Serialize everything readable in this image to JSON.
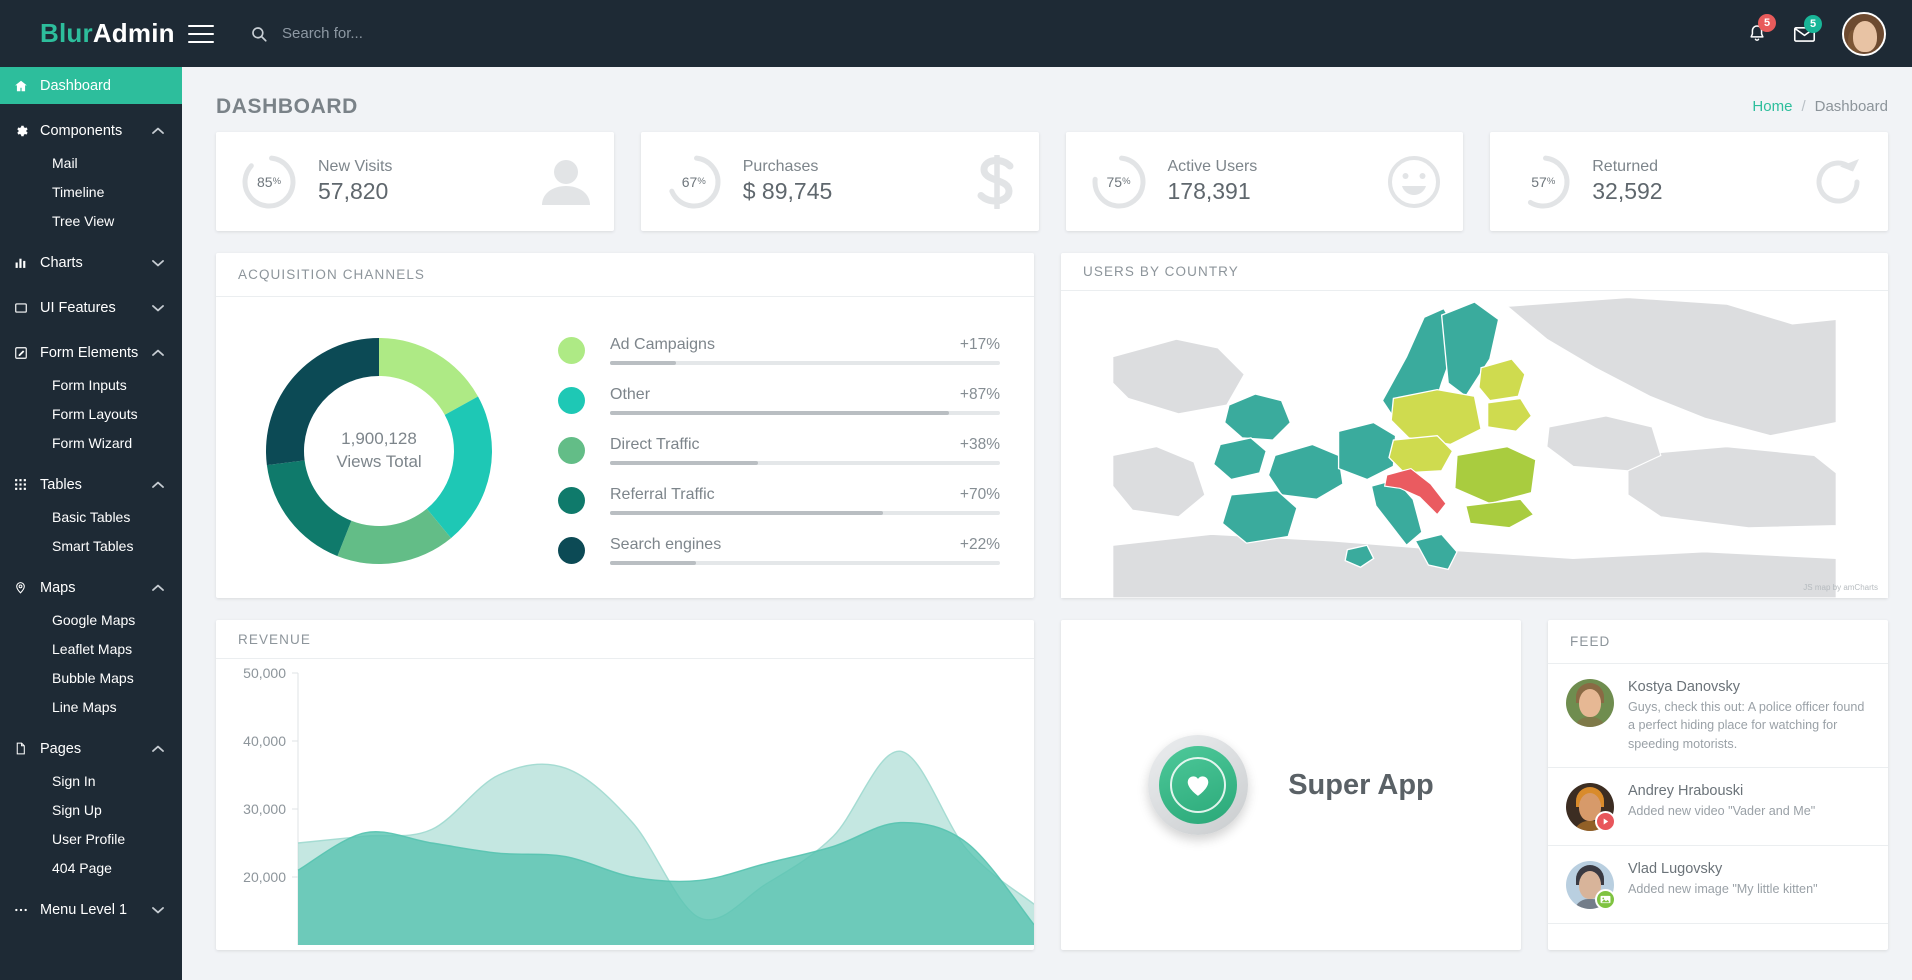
{
  "header": {
    "brand_first": "Blur",
    "brand_second": "Admin",
    "search_placeholder": "Search for...",
    "search_value": "",
    "notifications_count": "5",
    "messages_count": "5"
  },
  "sidebar": {
    "items": [
      {
        "label": "Dashboard",
        "icon": "home-icon",
        "type": "top",
        "active": true,
        "chevron": ""
      },
      {
        "label": "Components",
        "icon": "gear-icon",
        "type": "top",
        "active": false,
        "chevron": "up"
      },
      {
        "label": "Mail",
        "icon": "",
        "type": "sub"
      },
      {
        "label": "Timeline",
        "icon": "",
        "type": "sub"
      },
      {
        "label": "Tree View",
        "icon": "",
        "type": "sub"
      },
      {
        "label": "Charts",
        "icon": "bar-chart-icon",
        "type": "top",
        "active": false,
        "chevron": "down"
      },
      {
        "label": "UI Features",
        "icon": "square-icon",
        "type": "top",
        "active": false,
        "chevron": "down"
      },
      {
        "label": "Form Elements",
        "icon": "edit-icon",
        "type": "top",
        "active": false,
        "chevron": "up"
      },
      {
        "label": "Form Inputs",
        "icon": "",
        "type": "sub"
      },
      {
        "label": "Form Layouts",
        "icon": "",
        "type": "sub"
      },
      {
        "label": "Form Wizard",
        "icon": "",
        "type": "sub"
      },
      {
        "label": "Tables",
        "icon": "grid-icon",
        "type": "top",
        "active": false,
        "chevron": "up"
      },
      {
        "label": "Basic Tables",
        "icon": "",
        "type": "sub"
      },
      {
        "label": "Smart Tables",
        "icon": "",
        "type": "sub"
      },
      {
        "label": "Maps",
        "icon": "pin-icon",
        "type": "top",
        "active": false,
        "chevron": "up"
      },
      {
        "label": "Google Maps",
        "icon": "",
        "type": "sub"
      },
      {
        "label": "Leaflet Maps",
        "icon": "",
        "type": "sub"
      },
      {
        "label": "Bubble Maps",
        "icon": "",
        "type": "sub"
      },
      {
        "label": "Line Maps",
        "icon": "",
        "type": "sub"
      },
      {
        "label": "Pages",
        "icon": "file-icon",
        "type": "top",
        "active": false,
        "chevron": "up"
      },
      {
        "label": "Sign In",
        "icon": "",
        "type": "sub"
      },
      {
        "label": "Sign Up",
        "icon": "",
        "type": "sub"
      },
      {
        "label": "User Profile",
        "icon": "",
        "type": "sub"
      },
      {
        "label": "404 Page",
        "icon": "",
        "type": "sub"
      },
      {
        "label": "Menu Level 1",
        "icon": "dots-icon",
        "type": "top",
        "active": false,
        "chevron": "down"
      }
    ]
  },
  "page": {
    "title": "DASHBOARD",
    "breadcrumb_home": "Home",
    "breadcrumb_sep": "/",
    "breadcrumb_current": "Dashboard"
  },
  "stats": [
    {
      "percent": 85,
      "percent_label": "85",
      "percent_suffix": "%",
      "label": "New Visits",
      "value": "57,820",
      "icon": "person-icon"
    },
    {
      "percent": 67,
      "percent_label": "67",
      "percent_suffix": "%",
      "label": "Purchases",
      "value": "$ 89,745",
      "icon": "dollar-icon"
    },
    {
      "percent": 75,
      "percent_label": "75",
      "percent_suffix": "%",
      "label": "Active Users",
      "value": "178,391",
      "icon": "smiley-icon"
    },
    {
      "percent": 57,
      "percent_label": "57",
      "percent_suffix": "%",
      "label": "Returned",
      "value": "32,592",
      "icon": "refresh-icon"
    }
  ],
  "acquisition": {
    "title": "ACQUISITION CHANNELS",
    "center_value": "1,900,128",
    "center_label": "Views Total"
  },
  "users_by_country": {
    "title": "USERS BY COUNTRY",
    "attribution": "JS map by amCharts"
  },
  "revenue": {
    "title": "REVENUE"
  },
  "super_app": {
    "name": "Super App",
    "icon": "heart-icon"
  },
  "feed": {
    "title": "FEED",
    "items": [
      {
        "name": "Kostya Danovsky",
        "message": "Guys, check this out: A police officer found a perfect hiding place for watching for speeding motorists.",
        "badge": ""
      },
      {
        "name": "Andrey Hrabouski",
        "message": "Added new video \"Vader and Me\"",
        "badge": "video"
      },
      {
        "name": "Vlad Lugovsky",
        "message": "Added new image \"My little kitten\"",
        "badge": "image"
      }
    ]
  },
  "colors": {
    "accent": "#2dbe9c",
    "sidebar_bg": "#1e2a35",
    "page_bg": "#f1f3f6",
    "badge_red": "#e85b5b",
    "badge_teal": "#19b698",
    "map_teal": "#3aab9d",
    "map_lime": "#cfdb4f",
    "map_green": "#a9cc3f",
    "map_red": "#ea5b60",
    "map_gray": "#dcdddf"
  },
  "chart_data": [
    {
      "type": "pie",
      "title": "ACQUISITION CHANNELS",
      "center_text": "1,900,128 Views Total",
      "total_views": 1900128,
      "legend_position": "right",
      "categories": [
        "Ad Campaigns",
        "Other",
        "Direct Traffic",
        "Referral Traffic",
        "Search engines"
      ],
      "values": [
        17,
        87,
        38,
        70,
        22
      ],
      "value_labels": [
        "+17%",
        "+87%",
        "+38%",
        "+70%",
        "+22%"
      ],
      "slice_share": [
        17,
        22,
        17,
        17,
        27
      ],
      "colors": [
        "#aeea85",
        "#1ec8b5",
        "#63bd87",
        "#0f7a6b",
        "#0c4a55"
      ]
    },
    {
      "type": "area",
      "title": "REVENUE",
      "xlabel": "",
      "ylabel": "",
      "ylim": [
        10000,
        50000
      ],
      "yticks": [
        20000,
        30000,
        40000,
        50000
      ],
      "ytick_labels": [
        "20,000",
        "30,000",
        "40,000",
        "50,000"
      ],
      "grid": false,
      "series": [
        {
          "name": "series-1",
          "color": "#9fd9cf",
          "values": [
            25000,
            26000,
            27000,
            35000,
            36000,
            28000,
            14000,
            19000,
            26000,
            38500,
            24000,
            16000
          ]
        },
        {
          "name": "series-2",
          "color": "#57c3b0",
          "values": [
            21000,
            26500,
            25000,
            23500,
            23000,
            20000,
            19500,
            22000,
            24500,
            28000,
            25000,
            13000
          ]
        }
      ]
    },
    {
      "type": "heatmap",
      "title": "USERS BY COUNTRY",
      "subtype": "choropleth-map",
      "region": "Europe",
      "legend_position": "none",
      "categories": [
        "high-teal",
        "mid-lime",
        "mid-green",
        "alert-red",
        "no-data-gray"
      ],
      "values": [],
      "colors": [
        "#3aab9d",
        "#cfdb4f",
        "#a9cc3f",
        "#ea5b60",
        "#dcdddf"
      ]
    }
  ]
}
